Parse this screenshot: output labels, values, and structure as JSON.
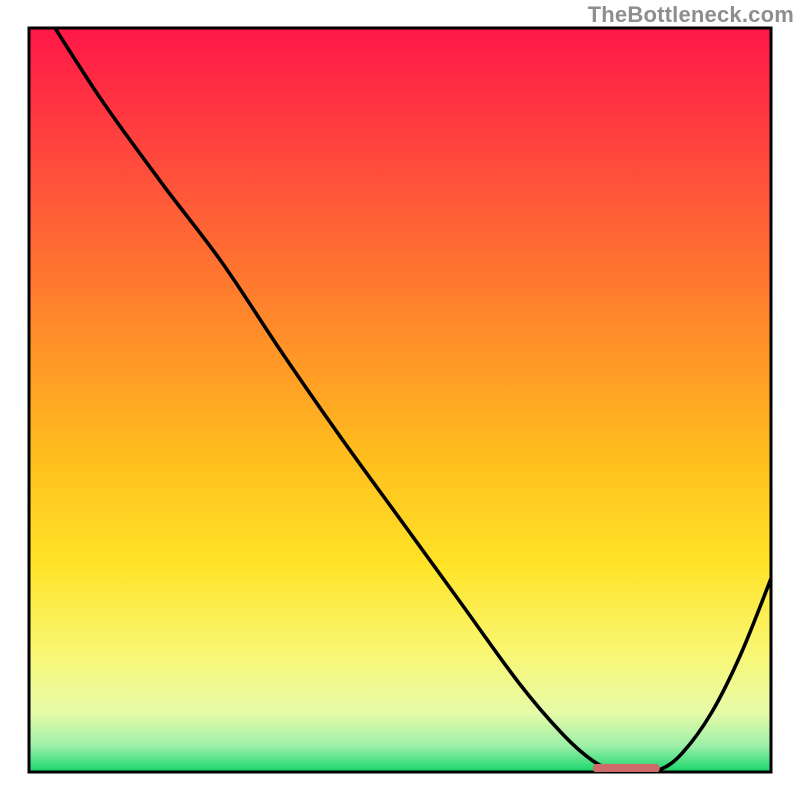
{
  "watermark": "TheBottleneck.com",
  "chart_data": {
    "type": "line",
    "title": "",
    "xlabel": "",
    "ylabel": "",
    "xlim": [
      0,
      100
    ],
    "ylim": [
      0,
      100
    ],
    "axes_visible": false,
    "background": {
      "description": "vertical gradient inside axes box, red→orange→yellow→pale-yellow→green from top to bottom",
      "stops": [
        {
          "offset": 0.0,
          "color": "#ff1748"
        },
        {
          "offset": 0.18,
          "color": "#ff4a3c"
        },
        {
          "offset": 0.4,
          "color": "#ff8a2a"
        },
        {
          "offset": 0.58,
          "color": "#ffbf1e"
        },
        {
          "offset": 0.72,
          "color": "#ffe327"
        },
        {
          "offset": 0.84,
          "color": "#f9f774"
        },
        {
          "offset": 0.92,
          "color": "#e6fba8"
        },
        {
          "offset": 0.965,
          "color": "#9cf0a8"
        },
        {
          "offset": 1.0,
          "color": "#17d66b"
        }
      ]
    },
    "series": [
      {
        "name": "curve",
        "color": "#000000",
        "x": [
          3.5,
          10,
          18,
          26,
          34,
          42,
          50,
          58,
          66,
          72,
          76,
          79,
          82,
          85,
          88,
          92,
          96,
          100
        ],
        "y": [
          100,
          90,
          79,
          68.5,
          56.5,
          45,
          34,
          23,
          12,
          5,
          1.5,
          0.2,
          0,
          0.3,
          2.5,
          8,
          16,
          26
        ]
      }
    ],
    "markers": [
      {
        "name": "bottom-marker",
        "shape": "rounded-bar",
        "color": "#cf6a6a",
        "x_center": 80.5,
        "y_center": 0.5,
        "width": 9,
        "height": 1.2
      }
    ]
  }
}
